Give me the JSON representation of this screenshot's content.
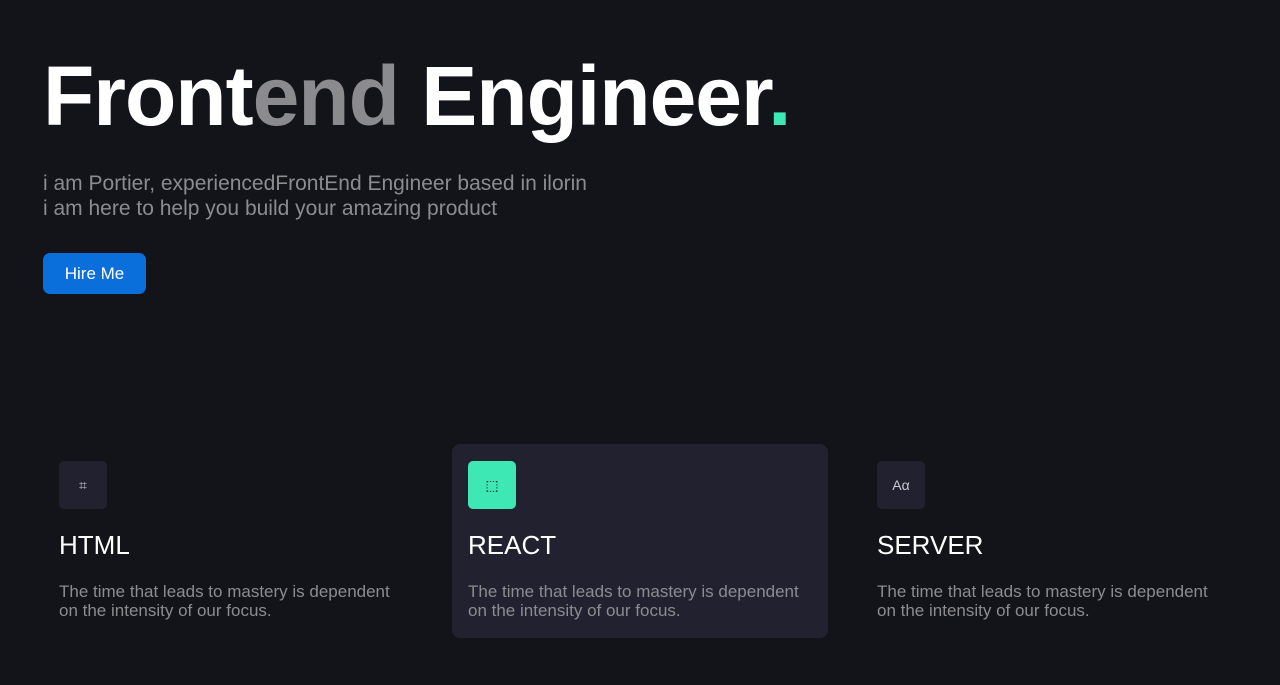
{
  "hero": {
    "title_part1": "Front",
    "title_part2": "end",
    "title_part3": " Engineer",
    "title_dot": ".",
    "subtitle_line1": "i am Portier, experiencedFrontEnd Engineer based in ilorin",
    "subtitle_line2": "i am here to help you build your amazing product",
    "cta_label": "Hire Me"
  },
  "colors": {
    "background": "#13131a",
    "accent": "#3ee8b5",
    "button": "#0b6fdb",
    "card_active": "#22212f"
  },
  "cards": [
    {
      "icon": "hash-icon",
      "icon_glyph": "⌗",
      "title": "HTML",
      "text": "The time that leads to mastery is dependent on the intensity of our focus.",
      "active": false
    },
    {
      "icon": "dashed-square-icon",
      "icon_glyph": "⬚",
      "title": "REACT",
      "text": "The time that leads to mastery is dependent on the intensity of our focus.",
      "active": true
    },
    {
      "icon": "font-icon",
      "icon_glyph": "Aα",
      "title": "SERVER",
      "text": "The time that leads to mastery is dependent on the intensity of our focus.",
      "active": false
    }
  ]
}
